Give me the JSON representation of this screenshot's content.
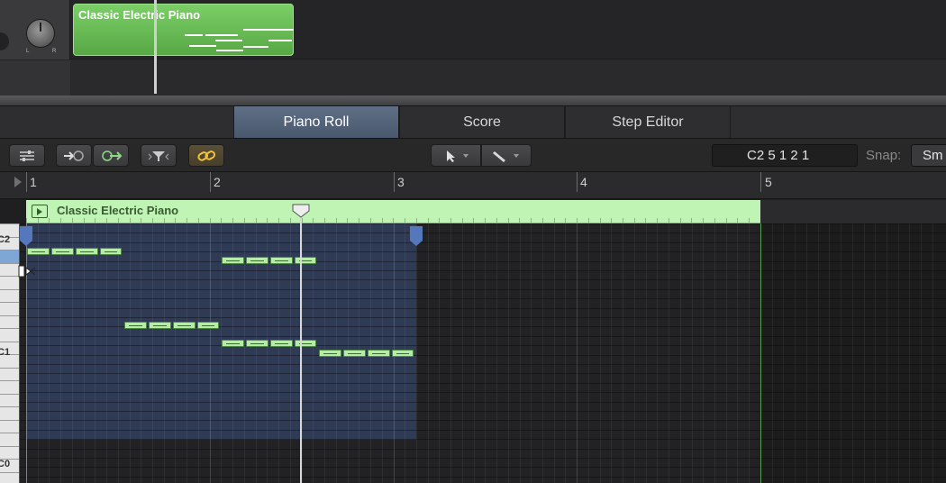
{
  "track": {
    "pan_left": "L",
    "pan_right": "R",
    "region_title": "Classic Electric Piano"
  },
  "tabs": [
    {
      "label": "Piano Roll",
      "active": true
    },
    {
      "label": "Score",
      "active": false
    },
    {
      "label": "Step Editor",
      "active": false
    }
  ],
  "toolbar": {
    "position_display": "C2   5 1 2 1",
    "snap_label": "Snap:",
    "snap_value": "Sm"
  },
  "ruler": {
    "bars": [
      "1",
      "2",
      "3",
      "4",
      "5"
    ]
  },
  "editor": {
    "region_title": "Classic Electric Piano",
    "key_labels": [
      "C2",
      "C1",
      "C0"
    ]
  },
  "colors": {
    "region_green": "#7bcf66",
    "note_fill": "#b7eba8",
    "selection_blue": "#2f3a55",
    "active_tab": "#55657a"
  }
}
